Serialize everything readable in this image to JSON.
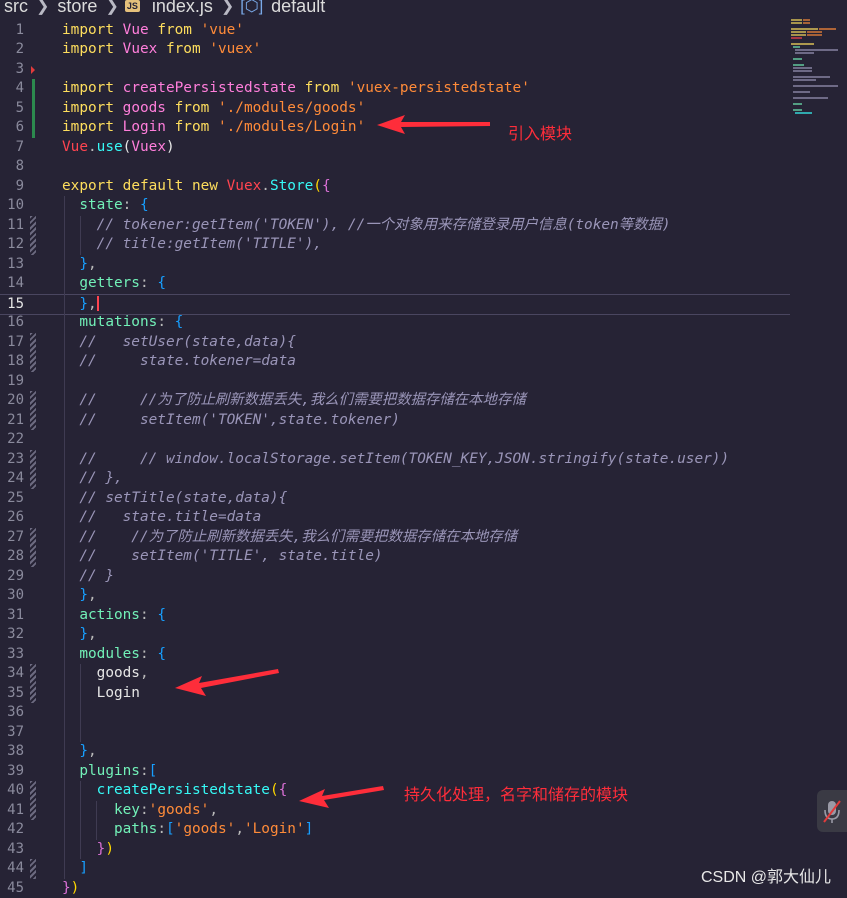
{
  "breadcrumb": {
    "src": "src",
    "store": "store",
    "js_badge": "JS",
    "file": "index.js",
    "symbol": "default"
  },
  "annotations": {
    "import_modules": "引入模块",
    "persist": "持久化处理，名字和储存的模块"
  },
  "watermark": "CSDN @郭大仙儿",
  "theme": {
    "background": "#262335",
    "annotation_color": "#fe2d3a"
  },
  "code_lines": [
    {
      "n": "1",
      "tokens": [
        {
          "t": "import ",
          "c": "kw"
        },
        {
          "t": "Vue ",
          "c": "id"
        },
        {
          "t": "from ",
          "c": "kw"
        },
        {
          "t": "'vue'",
          "c": "str"
        }
      ]
    },
    {
      "n": "2",
      "tokens": [
        {
          "t": "import ",
          "c": "kw"
        },
        {
          "t": "Vuex ",
          "c": "id"
        },
        {
          "t": "from ",
          "c": "kw"
        },
        {
          "t": "'vuex'",
          "c": "str"
        }
      ]
    },
    {
      "n": "3",
      "tokens": []
    },
    {
      "n": "4",
      "tokens": [
        {
          "t": "import ",
          "c": "kw"
        },
        {
          "t": "createPersistedstate ",
          "c": "id"
        },
        {
          "t": "from ",
          "c": "kw"
        },
        {
          "t": "'vuex-persistedstate'",
          "c": "str"
        }
      ]
    },
    {
      "n": "5",
      "tokens": [
        {
          "t": "import ",
          "c": "kw"
        },
        {
          "t": "goods ",
          "c": "id"
        },
        {
          "t": "from ",
          "c": "kw"
        },
        {
          "t": "'./modules/goods'",
          "c": "str"
        }
      ]
    },
    {
      "n": "6",
      "tokens": [
        {
          "t": "import ",
          "c": "kw"
        },
        {
          "t": "Login ",
          "c": "id"
        },
        {
          "t": "from ",
          "c": "kw"
        },
        {
          "t": "'./modules/Login'",
          "c": "str"
        }
      ]
    },
    {
      "n": "7",
      "tokens": [
        {
          "t": "Vue",
          "c": "cls"
        },
        {
          "t": ".",
          "c": "p"
        },
        {
          "t": "use",
          "c": "fn"
        },
        {
          "t": "(",
          "c": "br"
        },
        {
          "t": "Vuex",
          "c": "id"
        },
        {
          "t": ")",
          "c": "br"
        }
      ]
    },
    {
      "n": "8",
      "tokens": []
    },
    {
      "n": "9",
      "tokens": [
        {
          "t": "export ",
          "c": "kw"
        },
        {
          "t": "default ",
          "c": "kw"
        },
        {
          "t": "new ",
          "c": "kw"
        },
        {
          "t": "Vuex",
          "c": "cls"
        },
        {
          "t": ".",
          "c": "p"
        },
        {
          "t": "Store",
          "c": "fn"
        },
        {
          "t": "(",
          "c": "br1"
        },
        {
          "t": "{",
          "c": "br2"
        }
      ]
    },
    {
      "n": "10",
      "tokens": [
        {
          "t": "  state",
          "c": "prop"
        },
        {
          "t": ": ",
          "c": "p"
        },
        {
          "t": "{",
          "c": "br3"
        }
      ]
    },
    {
      "n": "11",
      "tokens": [
        {
          "t": "    // tokener:getItem('TOKEN'), //一个对象用来存储登录用户信息(token等数据)",
          "c": "cm"
        }
      ]
    },
    {
      "n": "12",
      "tokens": [
        {
          "t": "    // title:getItem('TITLE'),",
          "c": "cm"
        }
      ]
    },
    {
      "n": "13",
      "tokens": [
        {
          "t": "  ",
          "c": "w"
        },
        {
          "t": "}",
          "c": "br3"
        },
        {
          "t": ",",
          "c": "p"
        }
      ]
    },
    {
      "n": "14",
      "tokens": [
        {
          "t": "  getters",
          "c": "prop"
        },
        {
          "t": ": ",
          "c": "p"
        },
        {
          "t": "{",
          "c": "br3"
        }
      ]
    },
    {
      "n": "15",
      "tokens": [
        {
          "t": "  ",
          "c": "w"
        },
        {
          "t": "}",
          "c": "br3"
        },
        {
          "t": ",",
          "c": "p"
        }
      ],
      "cursor": true
    },
    {
      "n": "16",
      "tokens": [
        {
          "t": "  mutations",
          "c": "prop"
        },
        {
          "t": ": ",
          "c": "p"
        },
        {
          "t": "{",
          "c": "br3"
        }
      ]
    },
    {
      "n": "17",
      "tokens": [
        {
          "t": "  //   setUser(state,data){",
          "c": "cm"
        }
      ]
    },
    {
      "n": "18",
      "tokens": [
        {
          "t": "  //     state.tokener=data",
          "c": "cm"
        }
      ]
    },
    {
      "n": "19",
      "tokens": []
    },
    {
      "n": "20",
      "tokens": [
        {
          "t": "  //     //为了防止刷新数据丢失,我么们需要把数据存储在本地存储",
          "c": "cm"
        }
      ]
    },
    {
      "n": "21",
      "tokens": [
        {
          "t": "  //     setItem('TOKEN',state.tokener)",
          "c": "cm"
        }
      ]
    },
    {
      "n": "22",
      "tokens": []
    },
    {
      "n": "23",
      "tokens": [
        {
          "t": "  //     // window.localStorage.setItem(TOKEN_KEY,JSON.stringify(state.user))",
          "c": "cm"
        }
      ]
    },
    {
      "n": "24",
      "tokens": [
        {
          "t": "  // },",
          "c": "cm"
        }
      ]
    },
    {
      "n": "25",
      "tokens": [
        {
          "t": "  // setTitle(state,data){",
          "c": "cm"
        }
      ]
    },
    {
      "n": "26",
      "tokens": [
        {
          "t": "  //   state.title=data",
          "c": "cm"
        }
      ]
    },
    {
      "n": "27",
      "tokens": [
        {
          "t": "  //    //为了防止刷新数据丢失,我么们需要把数据存储在本地存储",
          "c": "cm"
        }
      ]
    },
    {
      "n": "28",
      "tokens": [
        {
          "t": "  //    setItem('TITLE', state.title)",
          "c": "cm"
        }
      ]
    },
    {
      "n": "29",
      "tokens": [
        {
          "t": "  // }",
          "c": "cm"
        }
      ]
    },
    {
      "n": "30",
      "tokens": [
        {
          "t": "  ",
          "c": "w"
        },
        {
          "t": "}",
          "c": "br3"
        },
        {
          "t": ",",
          "c": "p"
        }
      ]
    },
    {
      "n": "31",
      "tokens": [
        {
          "t": "  actions",
          "c": "prop"
        },
        {
          "t": ": ",
          "c": "p"
        },
        {
          "t": "{",
          "c": "br3"
        }
      ]
    },
    {
      "n": "32",
      "tokens": [
        {
          "t": "  ",
          "c": "w"
        },
        {
          "t": "}",
          "c": "br3"
        },
        {
          "t": ",",
          "c": "p"
        }
      ]
    },
    {
      "n": "33",
      "tokens": [
        {
          "t": "  modules",
          "c": "prop"
        },
        {
          "t": ": ",
          "c": "p"
        },
        {
          "t": "{",
          "c": "br3"
        }
      ]
    },
    {
      "n": "34",
      "tokens": [
        {
          "t": "    goods",
          "c": "w"
        },
        {
          "t": ",",
          "c": "p"
        }
      ]
    },
    {
      "n": "35",
      "tokens": [
        {
          "t": "    Login",
          "c": "w"
        }
      ]
    },
    {
      "n": "36",
      "tokens": []
    },
    {
      "n": "37",
      "tokens": []
    },
    {
      "n": "38",
      "tokens": [
        {
          "t": "  ",
          "c": "w"
        },
        {
          "t": "}",
          "c": "br3"
        },
        {
          "t": ",",
          "c": "p"
        }
      ]
    },
    {
      "n": "39",
      "tokens": [
        {
          "t": "  plugins",
          "c": "prop"
        },
        {
          "t": ":",
          "c": "p"
        },
        {
          "t": "[",
          "c": "br3"
        }
      ]
    },
    {
      "n": "40",
      "tokens": [
        {
          "t": "    ",
          "c": "w"
        },
        {
          "t": "createPersistedstate",
          "c": "fn"
        },
        {
          "t": "(",
          "c": "br1"
        },
        {
          "t": "{",
          "c": "br2"
        }
      ]
    },
    {
      "n": "41",
      "tokens": [
        {
          "t": "      key",
          "c": "prop"
        },
        {
          "t": ":",
          "c": "p"
        },
        {
          "t": "'goods'",
          "c": "str"
        },
        {
          "t": ",",
          "c": "p"
        }
      ]
    },
    {
      "n": "42",
      "tokens": [
        {
          "t": "      paths",
          "c": "prop"
        },
        {
          "t": ":",
          "c": "p"
        },
        {
          "t": "[",
          "c": "br3"
        },
        {
          "t": "'goods'",
          "c": "str"
        },
        {
          "t": ",",
          "c": "p"
        },
        {
          "t": "'Login'",
          "c": "str"
        },
        {
          "t": "]",
          "c": "br3"
        }
      ]
    },
    {
      "n": "43",
      "tokens": [
        {
          "t": "    ",
          "c": "w"
        },
        {
          "t": "}",
          "c": "br2"
        },
        {
          "t": ")",
          "c": "br1"
        }
      ]
    },
    {
      "n": "44",
      "tokens": [
        {
          "t": "  ",
          "c": "w"
        },
        {
          "t": "]",
          "c": "br3"
        }
      ]
    },
    {
      "n": "45",
      "tokens": [
        {
          "t": "}",
          "c": "br2"
        },
        {
          "t": ")",
          "c": "br1"
        }
      ]
    }
  ]
}
